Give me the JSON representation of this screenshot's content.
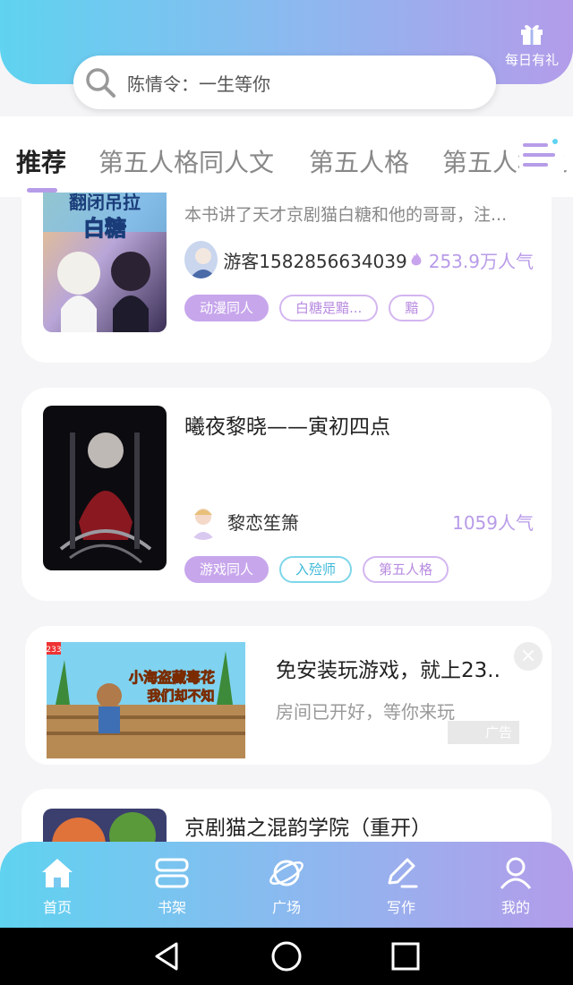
{
  "header": {
    "gift_label": "每日有礼",
    "search_placeholder": "陈情令：一生等你"
  },
  "tabs": [
    {
      "label": "推荐",
      "active": true
    },
    {
      "label": "第五人格同人文"
    },
    {
      "label": "第五人格"
    },
    {
      "label": "第五人格之"
    }
  ],
  "books": [
    {
      "cover_text_1": "翻闭吊拉",
      "cover_text_2": "白糖",
      "description": "本书讲了天才京剧猫白糖和他的哥哥，注...",
      "author": "游客1582856634039",
      "popularity": "253.9万人气",
      "tags": [
        "动漫同人",
        "白糖是黯...",
        "黯"
      ]
    },
    {
      "title": "曦夜黎晓——寅初四点",
      "author": "黎恋笙箫",
      "popularity": "1059人气",
      "tags": [
        "游戏同人",
        "入殓师",
        "第五人格"
      ]
    },
    {
      "title": "京剧猫之混韵学院（重开）"
    }
  ],
  "ad": {
    "title": "免安装玩游戏，就上23..",
    "subtitle": "房间已开好，等你来玩",
    "badge": "广告",
    "image_caption_1": "小海盗藏毒花",
    "image_caption_2": "我们却不知",
    "image_tag": "233"
  },
  "bottom_nav": [
    {
      "label": "首页",
      "icon": "home-icon"
    },
    {
      "label": "书架",
      "icon": "bookshelf-icon"
    },
    {
      "label": "广场",
      "icon": "planet-icon"
    },
    {
      "label": "写作",
      "icon": "pen-icon"
    },
    {
      "label": "我的",
      "icon": "user-icon"
    }
  ],
  "colors": {
    "accent_purple": "#b69ce8",
    "accent_cyan": "#5fd3f0",
    "popularity": "#b89be8"
  }
}
